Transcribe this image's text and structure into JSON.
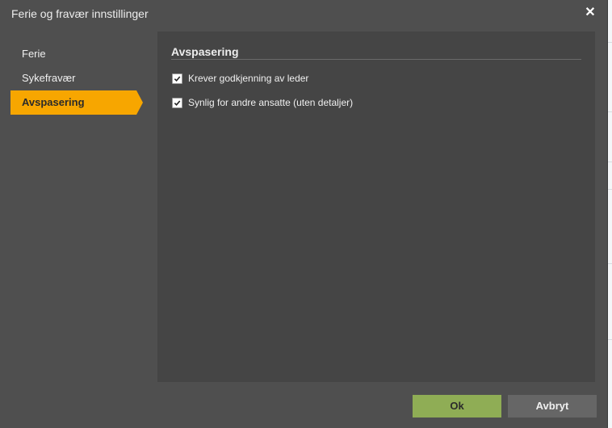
{
  "dialog": {
    "title": "Ferie og fravær innstillinger",
    "close_symbol": "✕"
  },
  "nav": {
    "items": [
      {
        "label": "Ferie",
        "active": false
      },
      {
        "label": "Sykefravær",
        "active": false
      },
      {
        "label": "Avspasering",
        "active": true
      }
    ]
  },
  "panel": {
    "title": "Avspasering",
    "options": [
      {
        "label": "Krever godkjenning av leder",
        "checked": true
      },
      {
        "label": "Synlig for andre ansatte (uten detaljer)",
        "checked": true
      }
    ]
  },
  "footer": {
    "ok_label": "Ok",
    "cancel_label": "Avbryt"
  },
  "colors": {
    "dialog_bg": "#4f4f4f",
    "panel_bg": "#454545",
    "active_nav": "#f7a600",
    "ok_button": "#8fad55",
    "cancel_button": "#666666"
  }
}
